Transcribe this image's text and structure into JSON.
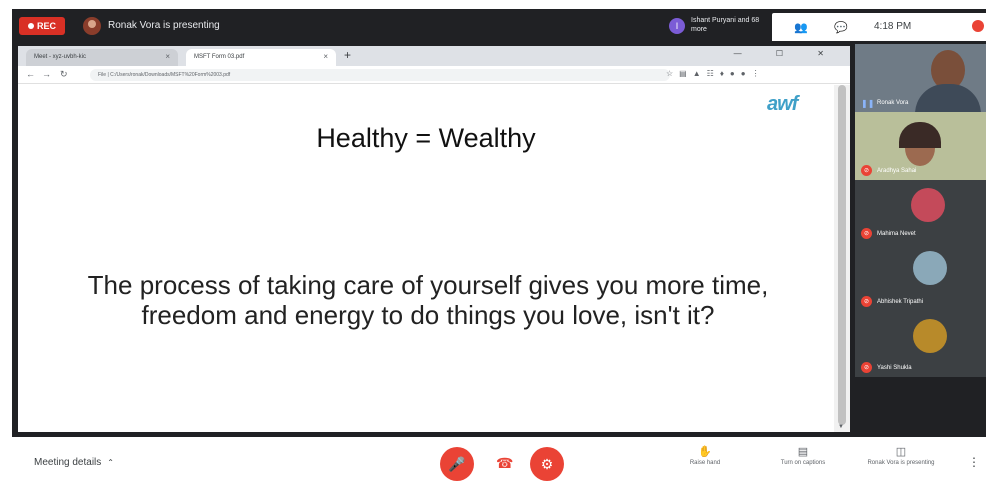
{
  "topbar": {
    "rec_label": "REC",
    "presenter_text": "Ronak Vora is presenting",
    "viewer_avatar": "I",
    "viewer_text": "Ishant Puryani and 68 more",
    "tray_time": "4:18 PM",
    "tray_date": "",
    "colors": {
      "rec": "#d93025",
      "viewer": "#7b5cd6"
    }
  },
  "browser": {
    "tabs": [
      {
        "label": "Meet - xyz-uvbh-kic",
        "close": "×"
      },
      {
        "label": "MSFT Form 03.pdf",
        "close": "×"
      }
    ],
    "new_tab": "+",
    "url": "File | C:/Users/ronak/Downloads/MSFT%20Form%2003.pdf",
    "window_controls": "—  ☐  ✕"
  },
  "slide": {
    "logo": "awf",
    "title": "Healthy = Wealthy",
    "body": "The process of taking care of yourself gives you more time, freedom and energy to do things you love, isn't it?"
  },
  "participants": [
    {
      "name": "Ronak Vora",
      "speaking": true
    },
    {
      "name": "Aradhya Sahai",
      "muted": true
    },
    {
      "name": "Mahima Nevet",
      "muted": true
    },
    {
      "name": "Abhishek Tripathi",
      "muted": true
    },
    {
      "name": "Yashi Shukla",
      "muted": true
    }
  ],
  "bottombar": {
    "meeting_details": "Meeting details",
    "raise_hand": "Raise hand",
    "captions": "Turn on captions",
    "present": "Ronak Vora is presenting",
    "more": "⋮",
    "colors": {
      "danger": "#ea4335"
    }
  }
}
